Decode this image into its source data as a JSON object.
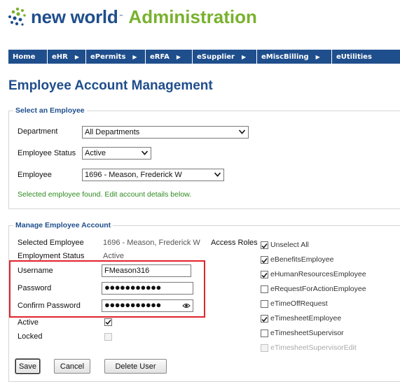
{
  "brand": {
    "name": "new world",
    "trademark": "™",
    "section": "Administration",
    "dot_color": "#79b12e",
    "name_color": "#1f4e8c"
  },
  "nav": [
    {
      "label": "Home",
      "arrow": false
    },
    {
      "label": "eHR",
      "arrow": true
    },
    {
      "label": "ePermits",
      "arrow": true
    },
    {
      "label": "eRFA",
      "arrow": true
    },
    {
      "label": "eSupplier",
      "arrow": true
    },
    {
      "label": "eMiscBilling",
      "arrow": true
    },
    {
      "label": "eUtilities",
      "arrow": false
    }
  ],
  "page_title": "Employee Account Management",
  "select_employee": {
    "legend": "Select an Employee",
    "department_label": "Department",
    "department_value": "All Departments",
    "status_label": "Employee Status",
    "status_value": "Active",
    "employee_label": "Employee",
    "employee_value": "1696 - Meason, Frederick W",
    "found_message": "Selected employee found. Edit account details below."
  },
  "manage_account": {
    "legend": "Manage Employee Account",
    "selected_employee_label": "Selected Employee",
    "selected_employee_value": "1696 - Meason, Frederick W",
    "employment_status_label": "Employment Status",
    "employment_status_value": "Active",
    "username_label": "Username",
    "username_value": "FMeason316",
    "password_label": "Password",
    "password_value": "●●●●●●●●●●●",
    "confirm_label": "Confirm Password",
    "confirm_value": "●●●●●●●●●●●",
    "active_label": "Active",
    "active_checked": true,
    "locked_label": "Locked",
    "locked_checked": false,
    "access_roles_label": "Access Roles",
    "roles": [
      {
        "label": "Unselect All",
        "checked": true,
        "disabled": false
      },
      {
        "label": "eBenefitsEmployee",
        "checked": true,
        "disabled": false
      },
      {
        "label": "eHumanResourcesEmployee",
        "checked": true,
        "disabled": false
      },
      {
        "label": "eRequestForActionEmployee",
        "checked": false,
        "disabled": false
      },
      {
        "label": "eTimeOffRequest",
        "checked": false,
        "disabled": false
      },
      {
        "label": "eTimesheetEmployee",
        "checked": true,
        "disabled": false
      },
      {
        "label": "eTimesheetSupervisor",
        "checked": false,
        "disabled": false
      },
      {
        "label": "eTimesheetSupervisorEdit",
        "checked": false,
        "disabled": true
      }
    ]
  },
  "buttons": {
    "save": "Save",
    "cancel": "Cancel",
    "delete": "Delete User"
  },
  "colors": {
    "navy": "#1f4e8c",
    "green": "#79b12e",
    "success": "#2e8b1f",
    "highlight": "#e0242a"
  }
}
